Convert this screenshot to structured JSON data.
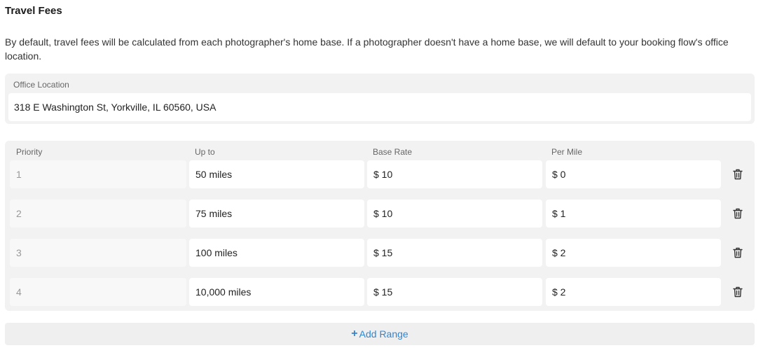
{
  "section": {
    "title": "Travel Fees",
    "description": "By default, travel fees will be calculated from each photographer's home base. If a photographer doesn't have a home base, we will default to your booking flow's office location."
  },
  "office": {
    "label": "Office Location",
    "value": "318 E Washington St, Yorkville, IL 60560, USA"
  },
  "table": {
    "headers": {
      "priority": "Priority",
      "up_to": "Up to",
      "base_rate": "Base Rate",
      "per_mile": "Per Mile"
    },
    "rows": [
      {
        "priority": "1",
        "up_to": "50 miles",
        "base_rate": "$ 10",
        "per_mile": "$ 0"
      },
      {
        "priority": "2",
        "up_to": "75 miles",
        "base_rate": "$ 10",
        "per_mile": "$ 1"
      },
      {
        "priority": "3",
        "up_to": "100 miles",
        "base_rate": "$ 15",
        "per_mile": "$ 2"
      },
      {
        "priority": "4",
        "up_to": "10,000 miles",
        "base_rate": "$ 15",
        "per_mile": "$ 2"
      }
    ],
    "row_action_icon": "trash-icon"
  },
  "actions": {
    "add_range_icon": "+",
    "add_range_label": "Add Range"
  },
  "colors": {
    "accent": "#2f86d6",
    "panel_bg": "#f2f2f2"
  }
}
